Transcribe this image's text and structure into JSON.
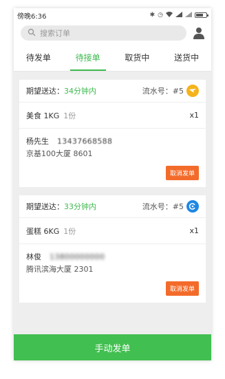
{
  "status_bar": {
    "time": "傍晚6:36",
    "icons": [
      "bluetooth-icon",
      "alarm-icon",
      "wifi-icon",
      "signal-icon",
      "signal-icon",
      "battery-icon"
    ]
  },
  "search": {
    "placeholder": "搜索订单"
  },
  "tabs": [
    {
      "label": "待发单",
      "active": false
    },
    {
      "label": "待接单",
      "active": true
    },
    {
      "label": "取货中",
      "active": false
    },
    {
      "label": "送货中",
      "active": false
    }
  ],
  "orders": [
    {
      "eta_label": "期望送达：",
      "eta_value": "34分钟内",
      "serial_label": "流水号：#5",
      "badge_color": "#f5b31b",
      "item_name": "美食 1KG",
      "item_count": "1份",
      "item_qty": "x1",
      "customer_name": "杨先生",
      "customer_phone": "13437668588",
      "address": "京基100大厦 8601",
      "cancel_label": "取消发单"
    },
    {
      "eta_label": "期望送达：",
      "eta_value": "33分钟内",
      "serial_label": "流水号：#5",
      "badge_color": "#1e88e5",
      "item_name": "蛋糕 6KG",
      "item_count": "1份",
      "item_qty": "x1",
      "customer_name": "林俊",
      "customer_phone": "13800000000",
      "address": "腾讯滨海大厦 2301",
      "cancel_label": "取消发单"
    }
  ],
  "bottom_button": {
    "label": "手动发单"
  },
  "colors": {
    "accent_green": "#3dba4e",
    "cancel_orange": "#f36b2a"
  }
}
